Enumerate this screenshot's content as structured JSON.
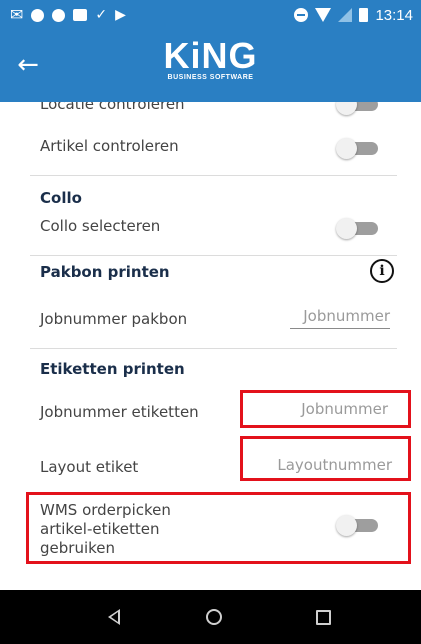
{
  "status_bar": {
    "time": "13:14",
    "left_icons": [
      "gmail-icon",
      "notification-dot-icon",
      "notification-dot-icon",
      "image-icon",
      "download-check-icon",
      "play-store-icon"
    ],
    "right_icons": [
      "do-not-disturb-icon",
      "wifi-icon",
      "signal-icon",
      "battery-icon"
    ]
  },
  "app_bar": {
    "back_icon": "arrow-left-icon",
    "logo_text": "KiNG",
    "logo_subtext": "BUSINESS SOFTWARE"
  },
  "settings": {
    "locatie_controleren": {
      "label": "Locatie controleren",
      "checked": false
    },
    "artikel_controleren": {
      "label": "Artikel controleren",
      "checked": false
    },
    "collo": {
      "title": "Collo",
      "collo_selecteren": {
        "label": "Collo selecteren",
        "checked": false
      }
    },
    "pakbon_printen": {
      "title": "Pakbon printen",
      "info_icon": "info-circle-icon",
      "jobnummer_pakbon": {
        "label": "Jobnummer pakbon",
        "placeholder": "Jobnummer"
      }
    },
    "etiketten_printen": {
      "title": "Etiketten printen",
      "jobnummer_etiketten": {
        "label": "Jobnummer etiketten",
        "placeholder": "Jobnummer"
      },
      "layout_etiket": {
        "label": "Layout etiket",
        "placeholder": "Layoutnummer"
      },
      "wms_orderpicken": {
        "label_line1": "WMS orderpicken",
        "label_line2": "artikel-etiketten",
        "label_line3": "gebruiken",
        "checked": false
      }
    }
  },
  "nav_bar": {
    "back": "nav-back-icon",
    "home": "nav-home-icon",
    "recents": "nav-recents-icon"
  },
  "colors": {
    "primary": "#2a7fc3",
    "highlight": "#e3111b"
  }
}
